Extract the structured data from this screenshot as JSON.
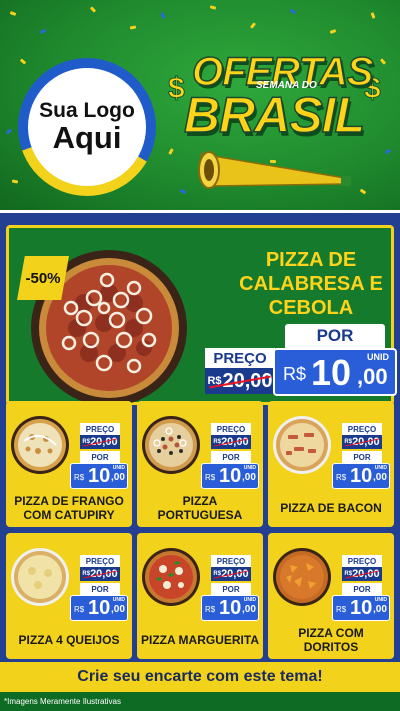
{
  "header": {
    "logo": {
      "line1": "Sua Logo",
      "line2": "Aqui"
    },
    "headline": {
      "top": "OFERTAS",
      "sub": "SEMANA DO",
      "bottom": "BRASIL",
      "currency_symbol": "$"
    }
  },
  "featured": {
    "discount": "-50%",
    "title": "PIZZA DE CALABRESA E CEBOLA",
    "preco_label": "PREÇO",
    "old_currency": "R$",
    "old_price": "20,00",
    "por_label": "POR",
    "new_currency": "R$",
    "new_int": "10",
    "new_cents": ",00",
    "unit": "UNID"
  },
  "cards": [
    {
      "name": "PIZZA DE FRANGO COM CATUPIRY",
      "preco": "PREÇO",
      "old_cur": "R$",
      "old": "20,00",
      "por": "POR",
      "cur": "R$",
      "int": "10",
      "cents": ",00",
      "unit": "UNID"
    },
    {
      "name": "PIZZA PORTUGUESA",
      "preco": "PREÇO",
      "old_cur": "R$",
      "old": "20,00",
      "por": "POR",
      "cur": "R$",
      "int": "10",
      "cents": ",00",
      "unit": "UNID"
    },
    {
      "name": "PIZZA DE BACON",
      "preco": "PREÇO",
      "old_cur": "R$",
      "old": "20,00",
      "por": "POR",
      "cur": "R$",
      "int": "10",
      "cents": ",00",
      "unit": "UNID"
    },
    {
      "name": "PIZZA 4 QUEIJOS",
      "preco": "PREÇO",
      "old_cur": "R$",
      "old": "20,00",
      "por": "POR",
      "cur": "R$",
      "int": "10",
      "cents": ",00",
      "unit": "UNID"
    },
    {
      "name": "PIZZA MARGUERITA",
      "preco": "PREÇO",
      "old_cur": "R$",
      "old": "20,00",
      "por": "POR",
      "cur": "R$",
      "int": "10",
      "cents": ",00",
      "unit": "UNID"
    },
    {
      "name": "PIZZA COM DORITOS",
      "preco": "PREÇO",
      "old_cur": "R$",
      "old": "20,00",
      "por": "POR",
      "cur": "R$",
      "int": "10",
      "cents": ",00",
      "unit": "UNID"
    }
  ],
  "footer": {
    "cta": "Crie seu encarte com este tema!",
    "disclaimer": "*Imagens Meramente Ilustrativas"
  },
  "colors": {
    "green": "#1f8a2e",
    "yellow": "#f2d21b",
    "blue": "#223f92",
    "price_blue": "#2a5ed8"
  }
}
